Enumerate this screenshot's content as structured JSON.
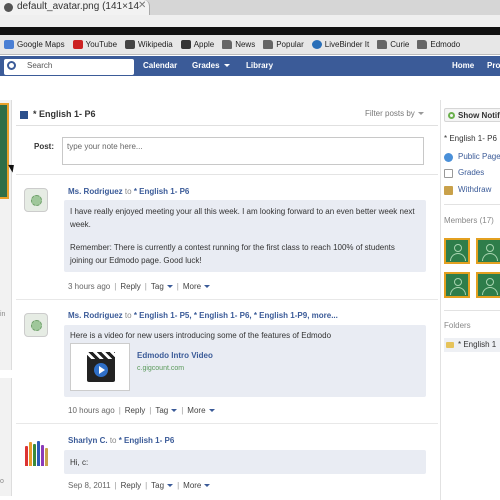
{
  "browser": {
    "tab_title": "default_avatar.png (141×14",
    "tab_close": "✕",
    "bookmarks": [
      {
        "label": "Google Maps",
        "icon": "map-icon"
      },
      {
        "label": "YouTube",
        "icon": "youtube-icon"
      },
      {
        "label": "Wikipedia",
        "icon": "wikipedia-icon"
      },
      {
        "label": "Apple",
        "icon": "apple-icon"
      },
      {
        "label": "News",
        "icon": "folder-icon"
      },
      {
        "label": "Popular",
        "icon": "folder-icon"
      },
      {
        "label": "LiveBinder It",
        "icon": "livebinder-icon"
      },
      {
        "label": "Curie",
        "icon": "folder-icon"
      },
      {
        "label": "Edmodo",
        "icon": "folder-icon"
      }
    ]
  },
  "nav": {
    "search_placeholder": "Search",
    "calendar": "Calendar",
    "grades": "Grades",
    "library": "Library",
    "home": "Home",
    "profile": "Pro"
  },
  "left": {
    "snippet1": "in",
    "snippet2": "o"
  },
  "feed": {
    "title": "* English 1- P6",
    "filter": "Filter posts by",
    "post_label": "Post:",
    "post_placeholder": "type your note here..."
  },
  "posts": [
    {
      "author": "Ms. Rodriguez",
      "to": "to",
      "recipients": "* English 1- P6",
      "text1": "I have really enjoyed meeting your all this week. I am looking forward to an even better week next week.",
      "text2": "Remember: There is currently a contest running for the first class to reach 100% of students joining our Edmodo page. Good luck!",
      "time": "3 hours ago",
      "reply": "Reply",
      "tag": "Tag",
      "more": "More"
    },
    {
      "author": "Ms. Rodriguez",
      "to": "to",
      "recipients": "* English 1- P5, * English 1- P6, * English 1-P9, more...",
      "text1": "Here is a video for new users introducing some of the features of Edmodo",
      "video_title": "Edmodo Intro Video",
      "video_url": "c.gigcount.com",
      "time": "10 hours ago",
      "reply": "Reply",
      "tag": "Tag",
      "more": "More"
    },
    {
      "author": "Sharlyn C.",
      "to": "to",
      "recipients": "* English 1- P6",
      "text1": "Hi, c:",
      "time": "Sep 8, 2011",
      "reply": "Reply",
      "tag": "Tag",
      "more": "More"
    }
  ],
  "sidebar": {
    "notif": "Show Notif",
    "group": "* English 1- P6",
    "public_page": "Public Page",
    "grades": "Grades",
    "withdraw": "Withdraw",
    "members_label": "Members",
    "members_count": "(17)",
    "folders_label": "Folders",
    "folder_item": "* English 1"
  },
  "colors": {
    "nav_blue": "#3b5b98",
    "bubble": "#e9ecf3",
    "member_green": "#2e7d4a",
    "member_border": "#e3a020"
  }
}
